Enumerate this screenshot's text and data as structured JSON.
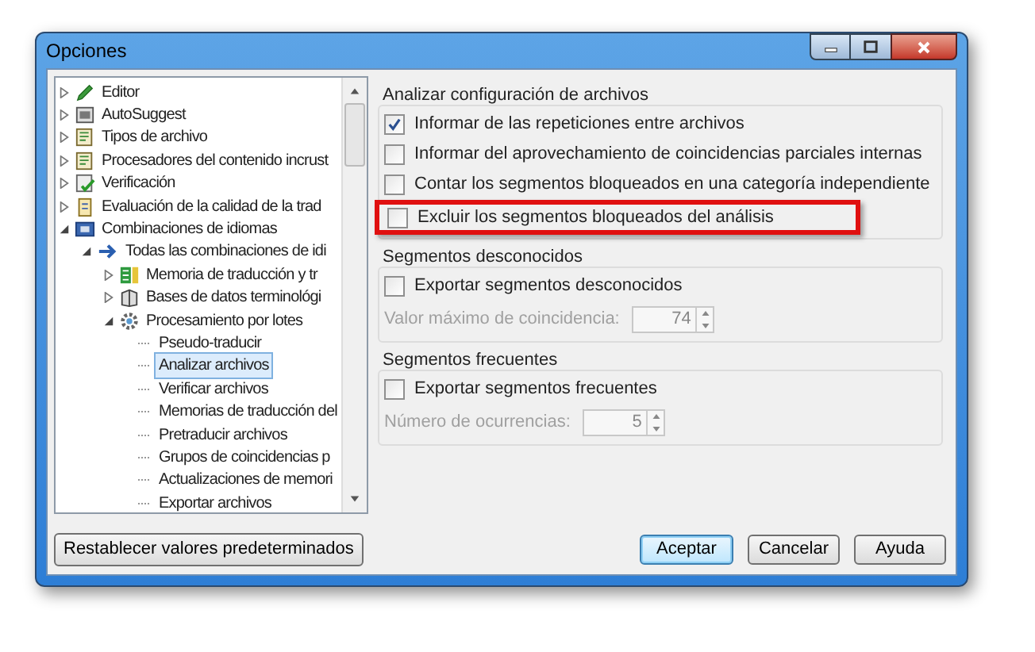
{
  "window": {
    "title": "Opciones"
  },
  "tree": [
    {
      "label": "Editor",
      "expanded": false
    },
    {
      "label": "AutoSuggest",
      "expanded": false
    },
    {
      "label": "Tipos de archivo",
      "expanded": false
    },
    {
      "label": "Procesadores del contenido incrust",
      "expanded": false
    },
    {
      "label": "Verificación",
      "expanded": false
    },
    {
      "label": "Evaluación de la calidad de la trad",
      "expanded": false
    },
    {
      "label": "Combinaciones de idiomas",
      "expanded": true,
      "children": [
        {
          "label": "Todas las combinaciones de idi",
          "expanded": true,
          "children": [
            {
              "label": "Memoria de traducción y tr",
              "expanded": false
            },
            {
              "label": "Bases de datos terminológi",
              "expanded": false
            },
            {
              "label": "Procesamiento por lotes",
              "expanded": true,
              "children": [
                {
                  "label": "Pseudo-traducir",
                  "selected": false
                },
                {
                  "label": "Analizar archivos",
                  "selected": true
                },
                {
                  "label": "Verificar archivos",
                  "selected": false
                },
                {
                  "label": "Memorias de traducción del",
                  "selected": false
                },
                {
                  "label": "Pretraducir archivos",
                  "selected": false
                },
                {
                  "label": "Grupos de coincidencias p",
                  "selected": false
                },
                {
                  "label": "Actualizaciones de memori",
                  "selected": false
                },
                {
                  "label": "Exportar archivos",
                  "selected": false
                }
              ]
            }
          ]
        }
      ]
    }
  ],
  "groups": [
    {
      "title": "Analizar configuración de archivos",
      "options": [
        {
          "label": "Informar de las repeticiones entre archivos",
          "checked": true,
          "highlighted": false
        },
        {
          "label": "Informar del aprovechamiento de coincidencias parciales internas",
          "checked": false,
          "highlighted": false
        },
        {
          "label": "Contar los segmentos bloqueados en una categoría independiente",
          "checked": false,
          "highlighted": false
        },
        {
          "label": "Excluir los segmentos bloqueados del análisis",
          "checked": false,
          "highlighted": true
        }
      ]
    },
    {
      "title": "Segmentos desconocidos",
      "options": [
        {
          "label": "Exportar segmentos desconocidos",
          "checked": false,
          "highlighted": false
        }
      ],
      "field": {
        "label": "Valor máximo de coincidencia:",
        "value": "74",
        "disabled": true
      }
    },
    {
      "title": "Segmentos frecuentes",
      "options": [
        {
          "label": "Exportar segmentos frecuentes",
          "checked": false,
          "highlighted": false
        }
      ],
      "field": {
        "label": "Número de ocurrencias:",
        "value": "5",
        "disabled": true
      }
    }
  ],
  "reset_button": "Restablecer valores predeterminados",
  "buttons": [
    {
      "label": "Aceptar",
      "default": true
    },
    {
      "label": "Cancelar",
      "default": false
    },
    {
      "label": "Ayuda",
      "default": false
    }
  ]
}
